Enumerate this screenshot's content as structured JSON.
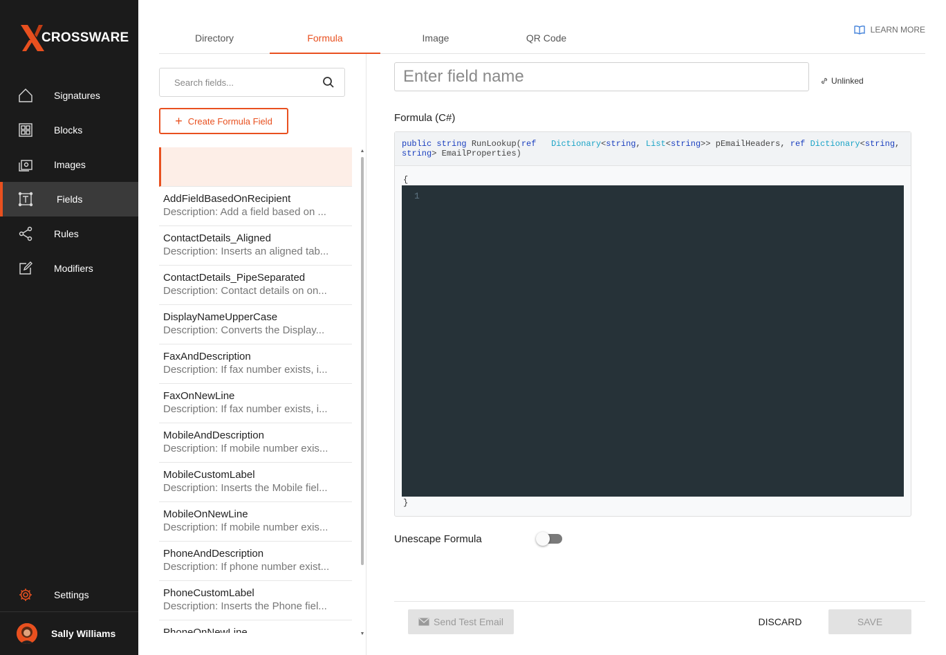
{
  "brand": {
    "name": "CROSSWARE",
    "accent": "#e8501f"
  },
  "sidebar": {
    "items": [
      {
        "label": "Signatures",
        "icon": "home-icon"
      },
      {
        "label": "Blocks",
        "icon": "blocks-icon"
      },
      {
        "label": "Images",
        "icon": "images-icon"
      },
      {
        "label": "Fields",
        "icon": "fields-icon",
        "active": true
      },
      {
        "label": "Rules",
        "icon": "rules-icon"
      },
      {
        "label": "Modifiers",
        "icon": "modifiers-icon"
      }
    ],
    "settings_label": "Settings",
    "user_name": "Sally Williams"
  },
  "tabs": [
    {
      "label": "Directory"
    },
    {
      "label": "Formula",
      "active": true
    },
    {
      "label": "Image"
    },
    {
      "label": "QR Code"
    }
  ],
  "learn_more": "LEARN MORE",
  "search": {
    "placeholder": "Search fields..."
  },
  "create_button": "Create Formula Field",
  "fields": [
    {
      "title": "AddFieldBasedOnRecipient",
      "desc": "Description: Add a field based on ..."
    },
    {
      "title": "ContactDetails_Aligned",
      "desc": "Description: Inserts an aligned tab..."
    },
    {
      "title": "ContactDetails_PipeSeparated",
      "desc": "Description: Contact details on on..."
    },
    {
      "title": "DisplayNameUpperCase",
      "desc": "Description: Converts the Display..."
    },
    {
      "title": "FaxAndDescription",
      "desc": "Description: If fax number exists, i..."
    },
    {
      "title": "FaxOnNewLine",
      "desc": "Description: If fax number exists, i..."
    },
    {
      "title": "MobileAndDescription",
      "desc": "Description: If mobile number exis..."
    },
    {
      "title": "MobileCustomLabel",
      "desc": "Description: Inserts the Mobile fiel..."
    },
    {
      "title": "MobileOnNewLine",
      "desc": "Description: If mobile number exis..."
    },
    {
      "title": "PhoneAndDescription",
      "desc": "Description: If phone number exist..."
    },
    {
      "title": "PhoneCustomLabel",
      "desc": "Description: Inserts the Phone fiel..."
    },
    {
      "title": "PhoneOnNewLine",
      "desc": ""
    }
  ],
  "editor": {
    "field_name_placeholder": "Enter field name",
    "link_status": "Unlinked",
    "formula_label": "Formula (C#)",
    "signature": {
      "t1": "public",
      "t2": "string",
      "t3": "RunLookup(",
      "t4": "ref",
      "t5": "Dictionary",
      "t6": "<",
      "t7": "string",
      "t8": ",",
      "t9": "List",
      "t10": "<",
      "t11": "string",
      "t12": ">> pEmailHeaders,",
      "t13": "ref",
      "t14": "Dictionary",
      "t15": "<",
      "t16": "string",
      "t17": ",",
      "t18": "string",
      "t19": "> EmailProperties)"
    },
    "open_brace": "{",
    "close_brace": "}",
    "line_number": "1",
    "unescape_label": "Unescape Formula",
    "unescape_on": false
  },
  "footer": {
    "send_test": "Send Test Email",
    "discard": "DISCARD",
    "save": "SAVE"
  }
}
